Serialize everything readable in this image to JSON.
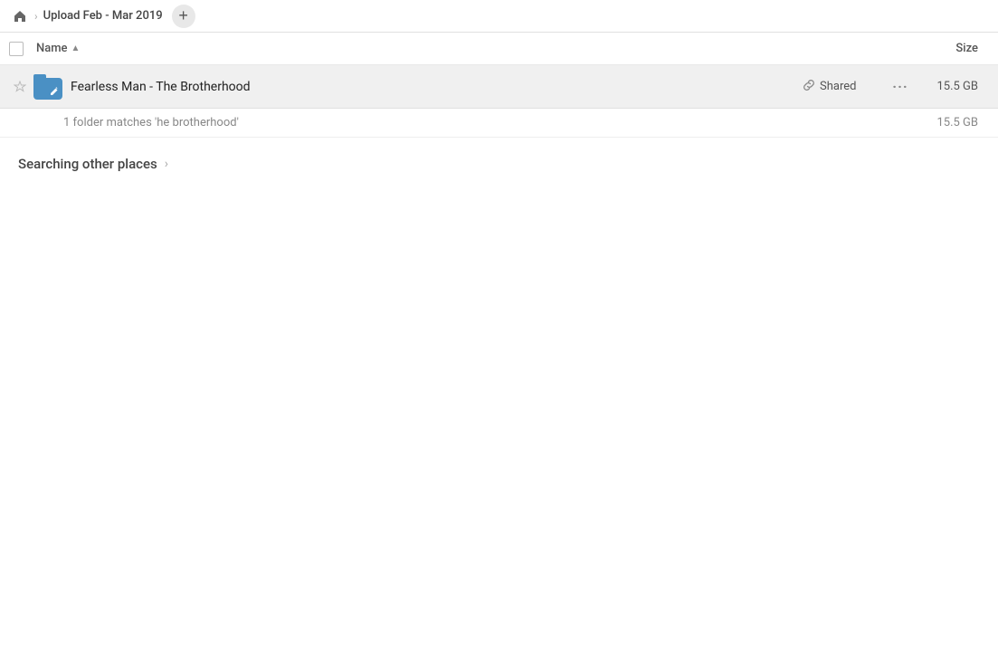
{
  "header": {
    "home_icon": "⌂",
    "separator": "›",
    "breadcrumb": "Upload Feb - Mar 2019",
    "add_button": "+"
  },
  "columns": {
    "name_label": "Name",
    "size_label": "Size"
  },
  "file_row": {
    "name": "Fearless Man - The Brotherhood",
    "shared_label": "Shared",
    "size": "15.5 GB",
    "more": "···"
  },
  "summary": {
    "text": "1 folder matches 'he brotherhood'",
    "size": "15.5 GB"
  },
  "searching": {
    "label": "Searching other places",
    "chevron": "›"
  }
}
